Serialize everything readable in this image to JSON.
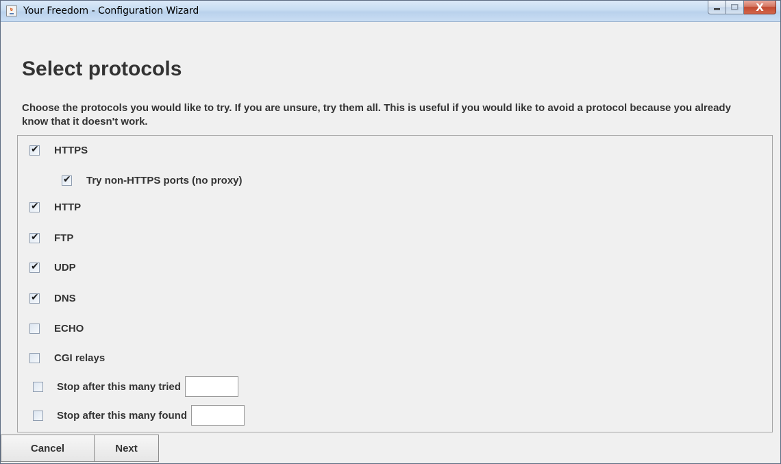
{
  "window": {
    "title": "Your Freedom - Configuration Wizard",
    "app_icon": "java-icon",
    "caption_buttons": [
      "minimize-icon",
      "maximize-icon",
      "close-icon"
    ],
    "close_glyph": "X"
  },
  "page": {
    "heading": "Select protocols",
    "description": "Choose the protocols you would like to try. If you are unsure, try them all. This is useful if you would like to avoid a protocol because you already know that it doesn't work."
  },
  "options": {
    "https": {
      "label": "HTTPS",
      "checked": true
    },
    "https_nonports": {
      "label": "Try non-HTTPS ports (no proxy)",
      "checked": true
    },
    "http": {
      "label": "HTTP",
      "checked": true
    },
    "ftp": {
      "label": "FTP",
      "checked": true
    },
    "udp": {
      "label": "UDP",
      "checked": true
    },
    "dns": {
      "label": "DNS",
      "checked": true
    },
    "echo": {
      "label": "ECHO",
      "checked": false
    },
    "cgi": {
      "label": "CGI relays",
      "checked": false
    },
    "stop_tried": {
      "label": "Stop after this many tried",
      "checked": false,
      "value": ""
    },
    "stop_found": {
      "label": "Stop after this many found",
      "checked": false,
      "value": ""
    }
  },
  "buttons": {
    "cancel": "Cancel",
    "next": "Next"
  },
  "colors": {
    "text": "#333333",
    "background": "#f0f0f0",
    "close_button": "#c14a31"
  }
}
